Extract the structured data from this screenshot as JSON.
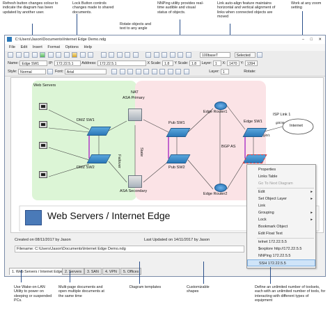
{
  "callouts": {
    "refresh": "Refresh button changes colour to indicate the diagram has been updated by another user.",
    "lock": "Lock Button controls changes made to shared documents.",
    "nnping": "NNPing utility provides real-time audible and visual status of objects.",
    "linkalign": "Link auto-align feature maintains horizontal and vertical alignment of links when connected objects are moved",
    "zoom": "Work at any zoom setting",
    "rotate": "Rotate objects and text to any angle",
    "wol": "Use Wake-on-LAN Utility to power on sleeping or suspended PCs.",
    "multipage": "Multi-page documents and open multiple documents at the same time",
    "templates": "Diagram templates",
    "shapes": "Customizable shapes",
    "toolsets": "Define an unlimited number of toolsets, each with an unlimited number of tools, for interacting with different types of equipment"
  },
  "window": {
    "title": "C:\\Users\\Jason\\Documents\\Internet Edge Demo.ndg",
    "menu": [
      "File",
      "Edit",
      "Insert",
      "Format",
      "Options",
      "Help"
    ],
    "toolbar": {
      "link_type": "100baseT",
      "selected": "Selected 0"
    },
    "props": {
      "name": "Edge SW1",
      "ip_label": "IP:",
      "ip": "172.22.5.1",
      "address_label": "Address:",
      "address": "172.22.5.1",
      "xscale_label": "X Scale:",
      "xscale": "1.8",
      "yscale_label": "Y Scale:",
      "yscale": "1.8",
      "layer_label": "Layer:",
      "layer": "1",
      "x_label": "X:",
      "x": "1470",
      "y_label": "Y:",
      "y": "1394",
      "rotate_label": "Rotate:",
      "style_label": "Style:",
      "style": "Normal",
      "font_label": "Font:",
      "font": "Arial",
      "layer2": "1"
    }
  },
  "diagram": {
    "web_servers": "Web Servers",
    "nat": "NAT",
    "asa_primary": "ASA Primary",
    "asa_secondary": "ASA Secondary",
    "failover": "Failover",
    "state": "State",
    "dmz_sw1": "DMZ SW1",
    "dmz_sw2": "DMZ SW2",
    "pub_sw1": "Pub SW1",
    "pub_sw2": "Pub SW2",
    "edge_router1": "Edge Router1",
    "edge_router2": "Edge Router2",
    "edge_sw1": "Edge SW1",
    "bgp": "BGP AS",
    "isp": "ISP Link 1",
    "internet": "Internet",
    "port_a": "gi0/1",
    "port_b": "gi0/48",
    "title": "Web Servers / Internet Edge",
    "created": "Created on 08/11/2017 by Jason",
    "updated": "Last Updated on 14/11/2017 by Jason",
    "filename": "Filename: C:\\Users\\Jason\\Documents\\Internet Edge Demo.ndg"
  },
  "context_menu": [
    {
      "label": "Properties",
      "state": "normal"
    },
    {
      "label": "Links Table",
      "state": "normal"
    },
    {
      "label": "Go To Next Diagram",
      "state": "disabled"
    },
    {
      "label": "Edit",
      "state": "submenu"
    },
    {
      "label": "Set Object Layer",
      "state": "submenu"
    },
    {
      "label": "Link",
      "state": "normal"
    },
    {
      "label": "Grouping",
      "state": "submenu"
    },
    {
      "label": "Lock",
      "state": "submenu"
    },
    {
      "label": "Bookmark Object",
      "state": "normal"
    },
    {
      "label": "Edit Float Text",
      "state": "normal"
    },
    {
      "label": "telnet 172.22.5.5",
      "state": "normal"
    },
    {
      "label": "$explore http://172.22.5.5",
      "state": "normal"
    },
    {
      "label": "NNPing 172.22.5.5",
      "state": "normal"
    },
    {
      "label": "SSH 172.22.5.5",
      "state": "selected"
    }
  ],
  "tabs": [
    "1. Web Servers / Internet Edge",
    "2. Servers",
    "3. SAN",
    "4. VPN",
    "5. Offices"
  ],
  "colors": {
    "accent": "#2b79b9",
    "green_zone": "#dcf5d6",
    "pink_zone": "#fbe3e6",
    "callout_line": "#2a4f8a"
  }
}
